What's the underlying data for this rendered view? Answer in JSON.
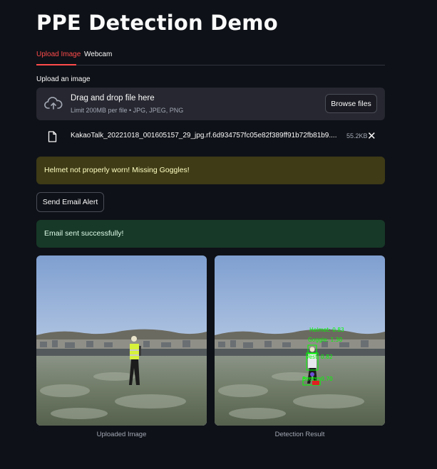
{
  "title": "PPE Detection Demo",
  "tabs": [
    {
      "label": "Upload Image",
      "active": true
    },
    {
      "label": "Webcam",
      "active": false
    }
  ],
  "uploader": {
    "label": "Upload an image",
    "drag_text": "Drag and drop file here",
    "limit_text": "Limit 200MB per file • JPG, JPEG, PNG",
    "browse_label": "Browse files",
    "icon": "cloud-upload-icon"
  },
  "file": {
    "name": "KakaoTalk_20221018_001605157_29_jpg.rf.6d934757fc05e82f389ff91b72fb81b9....",
    "size": "55.2KB",
    "icon": "file-icon"
  },
  "warning_text": "Helmet not properly worn! Missing Goggles!",
  "email_button": "Send Email Alert",
  "success_text": "Email sent successfully!",
  "images": {
    "uploaded_caption": "Uploaded Image",
    "result_caption": "Detection Result"
  },
  "colors": {
    "accent": "#ff4b4b",
    "warning_bg": "#3e3b16",
    "success_bg": "#173928",
    "detection_box": "#00ff00"
  }
}
